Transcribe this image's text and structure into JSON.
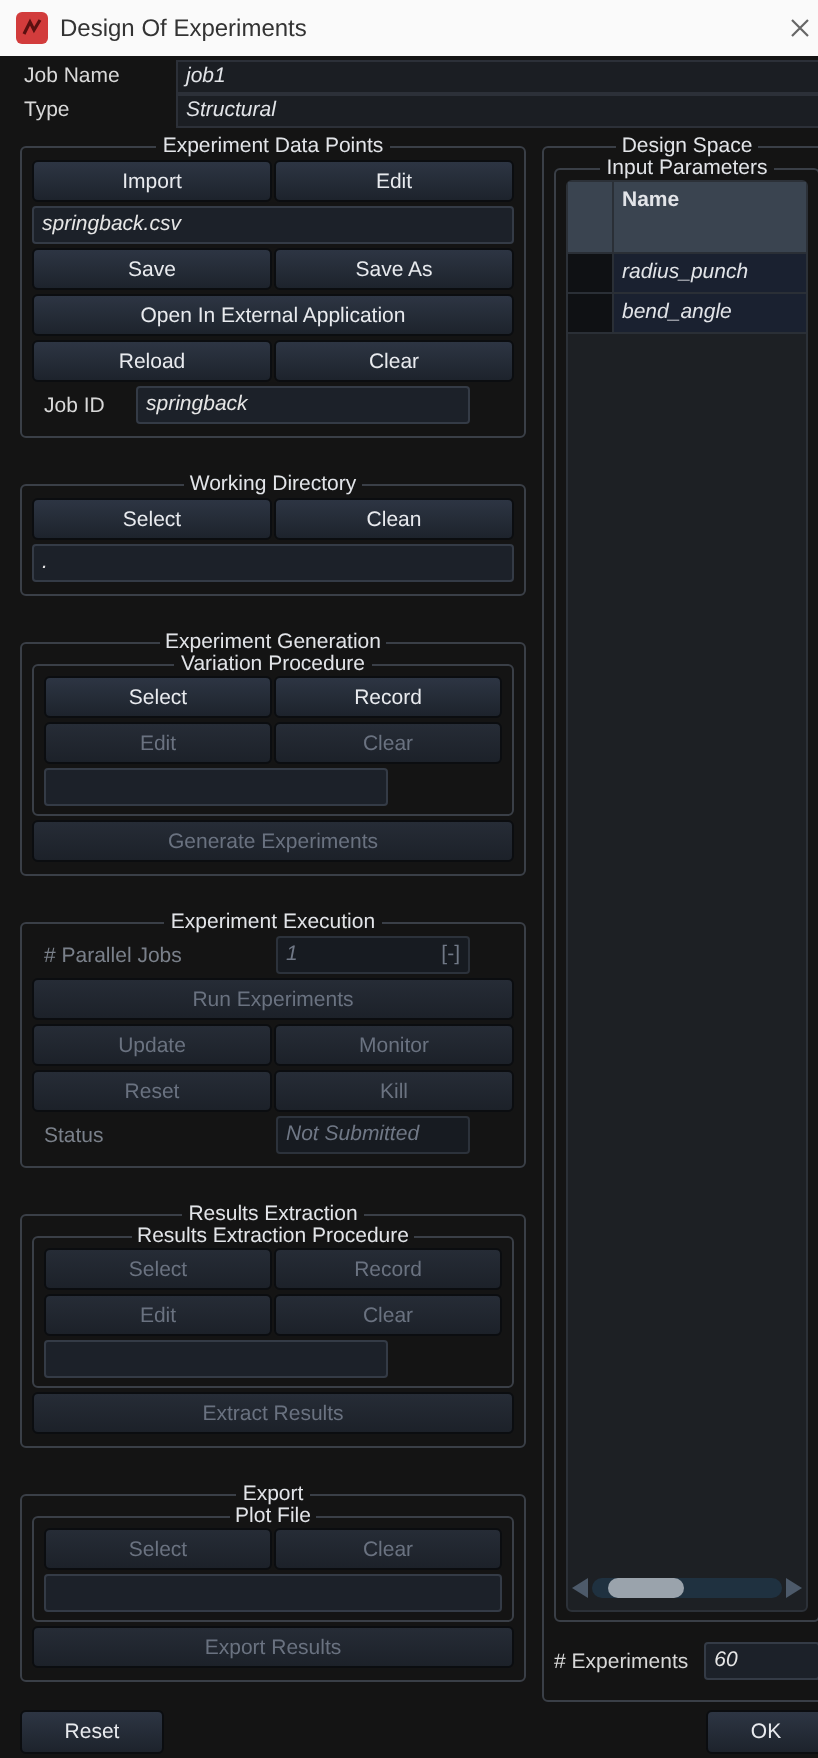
{
  "window": {
    "title": "Design Of Experiments"
  },
  "job": [
    {
      "label": "Job Name",
      "value": "job1"
    },
    {
      "label": "Type",
      "value": "Structural"
    }
  ],
  "groups": [
    {
      "title": "Experiment Data Points",
      "rows": [
        {
          "kind": "buttons",
          "buttons": [
            {
              "label": "Import",
              "disabled": false
            },
            {
              "label": "Edit",
              "disabled": false
            }
          ]
        },
        {
          "kind": "field",
          "value": "springback.csv",
          "disabled": false
        },
        {
          "kind": "buttons",
          "buttons": [
            {
              "label": "Save",
              "disabled": false
            },
            {
              "label": "Save As",
              "disabled": false
            }
          ]
        },
        {
          "kind": "buttons",
          "buttons": [
            {
              "label": "Open In External Application",
              "disabled": false
            }
          ]
        },
        {
          "kind": "buttons",
          "buttons": [
            {
              "label": "Reload",
              "disabled": false
            },
            {
              "label": "Clear",
              "disabled": false
            }
          ]
        },
        {
          "kind": "labeled",
          "label": "Job ID",
          "value": "springback",
          "disabled": false
        }
      ]
    },
    {
      "title": "Working Directory",
      "rows": [
        {
          "kind": "buttons",
          "buttons": [
            {
              "label": "Select",
              "disabled": false
            },
            {
              "label": "Clean",
              "disabled": false
            }
          ]
        },
        {
          "kind": "field",
          "value": ".",
          "disabled": false
        }
      ]
    },
    {
      "title": "Experiment Generation",
      "rows": [
        {
          "kind": "group",
          "title": "Variation Procedure",
          "rows": [
            {
              "kind": "buttons",
              "buttons": [
                {
                  "label": "Select",
                  "disabled": false
                },
                {
                  "label": "Record",
                  "disabled": false
                }
              ]
            },
            {
              "kind": "buttons",
              "buttons": [
                {
                  "label": "Edit",
                  "disabled": true
                },
                {
                  "label": "Clear",
                  "disabled": true
                }
              ]
            },
            {
              "kind": "short_field"
            }
          ]
        },
        {
          "kind": "buttons",
          "buttons": [
            {
              "label": "Generate Experiments",
              "disabled": true
            }
          ]
        }
      ]
    },
    {
      "title": "Experiment Execution",
      "rows": [
        {
          "kind": "labeled",
          "label": "# Parallel Jobs",
          "value": "1",
          "suffix": "[-]",
          "disabled": true
        },
        {
          "kind": "buttons",
          "buttons": [
            {
              "label": "Run Experiments",
              "disabled": true
            }
          ]
        },
        {
          "kind": "buttons",
          "buttons": [
            {
              "label": "Update",
              "disabled": true
            },
            {
              "label": "Monitor",
              "disabled": true
            }
          ]
        },
        {
          "kind": "buttons",
          "buttons": [
            {
              "label": "Reset",
              "disabled": true
            },
            {
              "label": "Kill",
              "disabled": true
            }
          ]
        },
        {
          "kind": "labeled",
          "label": "Status",
          "value": "Not Submitted",
          "disabled": true
        }
      ]
    },
    {
      "title": "Results Extraction",
      "rows": [
        {
          "kind": "group",
          "title": "Results Extraction Procedure",
          "rows": [
            {
              "kind": "buttons",
              "buttons": [
                {
                  "label": "Select",
                  "disabled": true
                },
                {
                  "label": "Record",
                  "disabled": true
                }
              ]
            },
            {
              "kind": "buttons",
              "buttons": [
                {
                  "label": "Edit",
                  "disabled": true
                },
                {
                  "label": "Clear",
                  "disabled": true
                }
              ]
            },
            {
              "kind": "short_field"
            }
          ]
        },
        {
          "kind": "buttons",
          "buttons": [
            {
              "label": "Extract Results",
              "disabled": true
            }
          ]
        }
      ]
    },
    {
      "title": "Export",
      "rows": [
        {
          "kind": "group",
          "title": "Plot File",
          "rows": [
            {
              "kind": "buttons",
              "buttons": [
                {
                  "label": "Select",
                  "disabled": true
                },
                {
                  "label": "Clear",
                  "disabled": true
                }
              ]
            },
            {
              "kind": "field"
            }
          ]
        },
        {
          "kind": "buttons",
          "buttons": [
            {
              "label": "Export Results",
              "disabled": true
            }
          ]
        }
      ]
    }
  ],
  "design_space": {
    "title": "Design Space",
    "input_parameters": {
      "title": "Input Parameters",
      "columns": [
        "Name"
      ],
      "rows": [
        {
          "name": "radius_punch"
        },
        {
          "name": "bend_angle"
        }
      ]
    },
    "experiments": {
      "label": "# Experiments",
      "value": "60"
    }
  },
  "footer": {
    "buttons": [
      "Reset",
      "OK"
    ]
  }
}
